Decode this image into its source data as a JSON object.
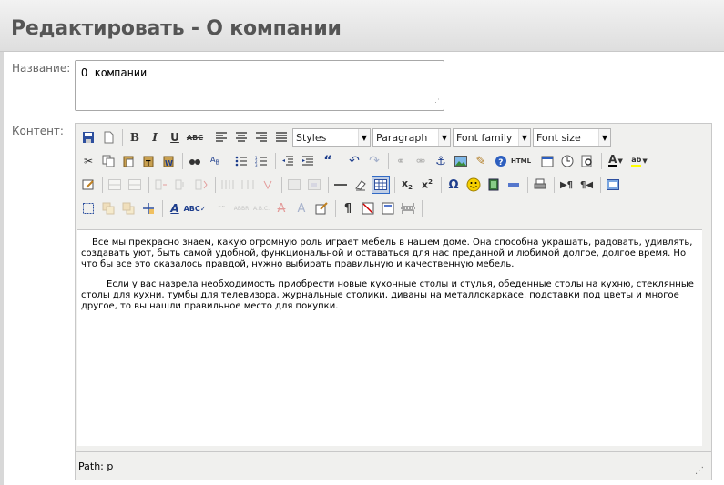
{
  "page": {
    "title": "Редактировать - О компании"
  },
  "form": {
    "name_label": "Название:",
    "name_value": "О компании",
    "content_label": "Контент:"
  },
  "toolbar": {
    "styles": "Styles",
    "format": "Paragraph",
    "font_family": "Font family",
    "font_size": "Font size",
    "html_label": "HTML"
  },
  "content": {
    "paragraph_1": "Все мы прекрасно знаем, какую огромную роль играет мебель в нашем доме. Она способна украшать, радовать, удивлять, создавать уют, быть самой удобной, функциональной  и оставаться для нас преданной и любимой долгое, долгое время. Но что бы все это оказалось правдой, нужно выбирать правильную и качественную мебель.",
    "paragraph_2": "Если у вас назрела необходимость приобрести новые  кухонные столы и стулья,  обеденные столы на кухню, стеклянные столы для кухни, тумбы для телевизора, журнальные столики, диваны на металлокаркасе, подставки под цветы и многое другое, то вы нашли правильное место для покупки."
  },
  "status": {
    "path": "Path: p"
  }
}
